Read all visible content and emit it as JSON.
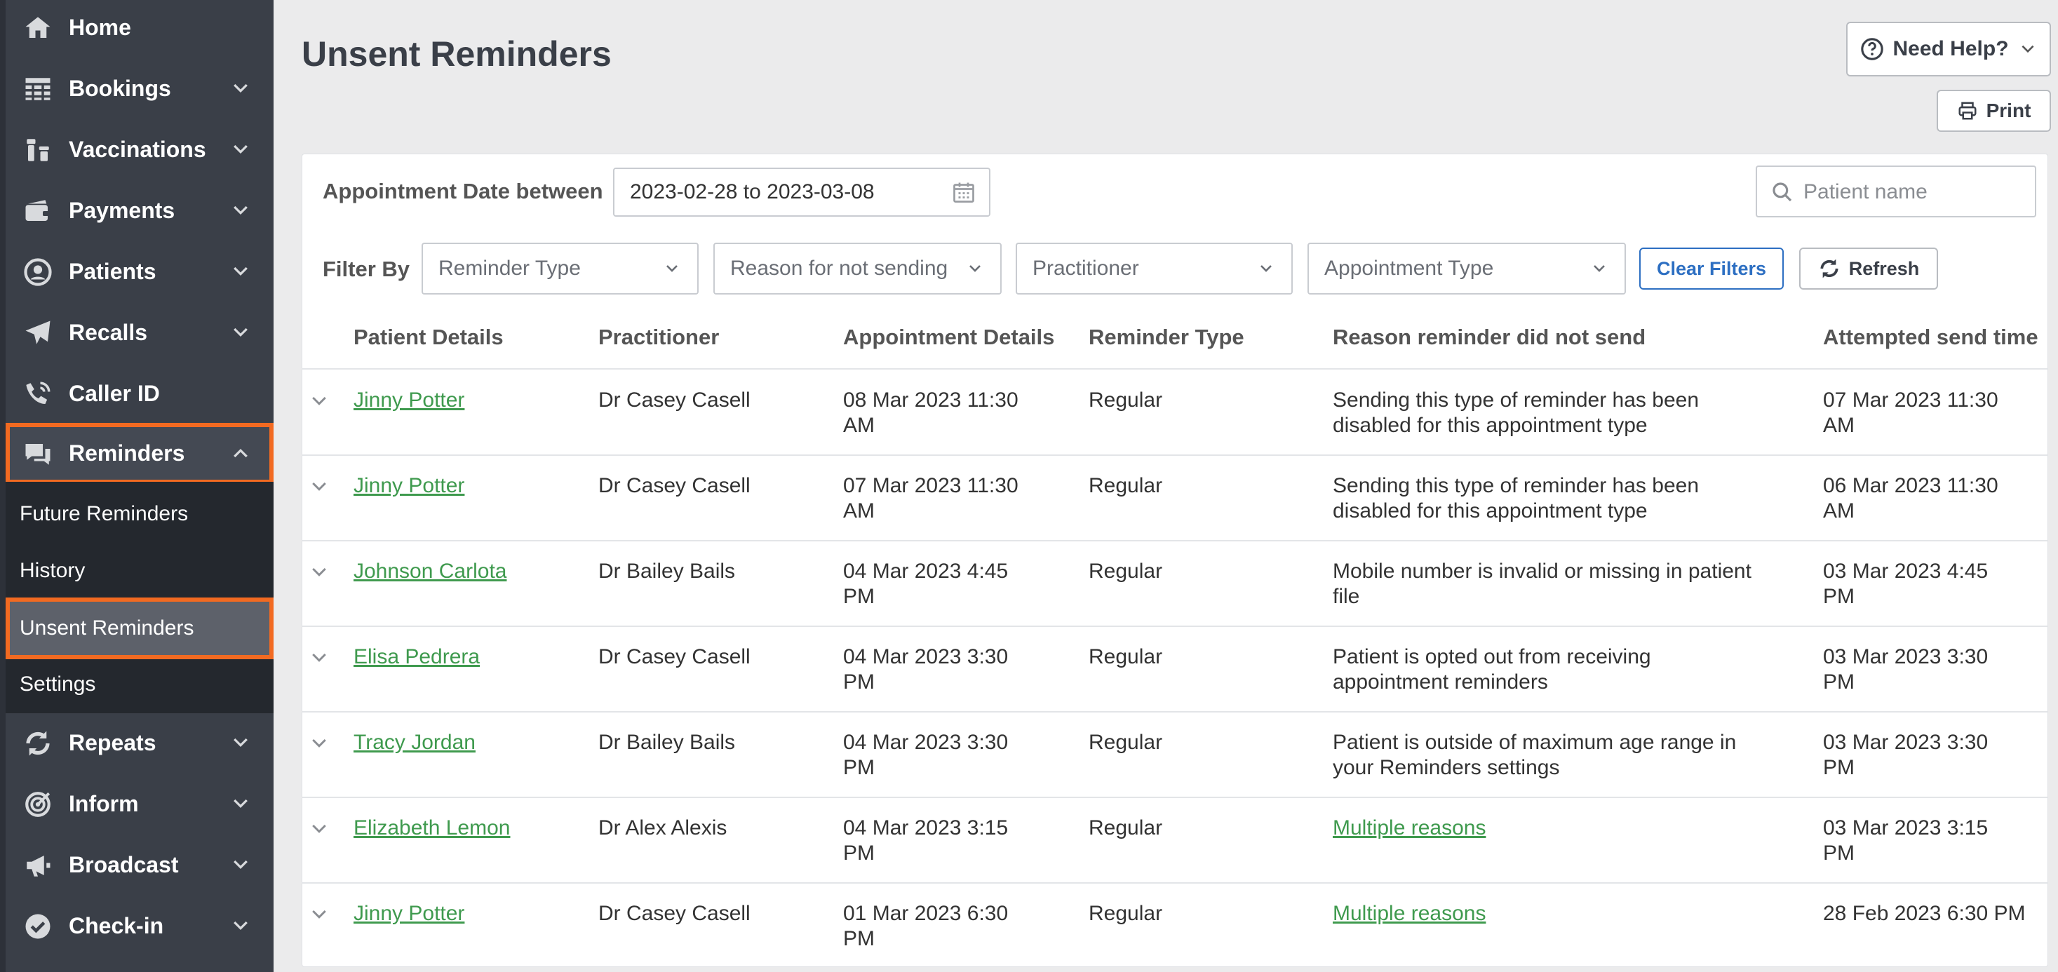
{
  "sidebar": {
    "items": [
      {
        "label": "Home",
        "icon": "home-icon",
        "has_chevron": false
      },
      {
        "label": "Bookings",
        "icon": "calendar-grid-icon",
        "has_chevron": true
      },
      {
        "label": "Vaccinations",
        "icon": "vials-icon",
        "has_chevron": true
      },
      {
        "label": "Payments",
        "icon": "card-payment-icon",
        "has_chevron": true
      },
      {
        "label": "Patients",
        "icon": "user-circle-icon",
        "has_chevron": true
      },
      {
        "label": "Recalls",
        "icon": "paper-plane-icon",
        "has_chevron": true
      },
      {
        "label": "Caller ID",
        "icon": "phone-icon",
        "has_chevron": false
      },
      {
        "label": "Reminders",
        "icon": "chat-bubbles-icon",
        "has_chevron": true,
        "expanded": true
      },
      {
        "label": "Repeats",
        "icon": "repeat-icon",
        "has_chevron": true
      },
      {
        "label": "Inform",
        "icon": "target-icon",
        "has_chevron": true
      },
      {
        "label": "Broadcast",
        "icon": "megaphone-icon",
        "has_chevron": true
      },
      {
        "label": "Check-in",
        "icon": "check-badge-icon",
        "has_chevron": true
      }
    ],
    "reminders_submenu": [
      {
        "label": "Future Reminders"
      },
      {
        "label": "History"
      },
      {
        "label": "Unsent Reminders",
        "active": true
      },
      {
        "label": "Settings"
      }
    ],
    "highlight_color": "#f26a21"
  },
  "header": {
    "title": "Unsent Reminders",
    "help_label": "Need Help?",
    "print_label": "Print"
  },
  "filters": {
    "date_label": "Appointment Date between",
    "date_value": "2023-02-28 to 2023-03-08",
    "search_placeholder": "Patient name",
    "filter_by_label": "Filter By",
    "reminder_type": "Reminder Type",
    "reason": "Reason for not sending",
    "practitioner": "Practitioner",
    "appointment_type": "Appointment Type",
    "clear_label": "Clear Filters",
    "refresh_label": "Refresh"
  },
  "table": {
    "columns": [
      "Patient Details",
      "Practitioner",
      "Appointment Details",
      "Reminder Type",
      "Reason reminder did not send",
      "Attempted send time"
    ],
    "rows": [
      {
        "patient": "Jinny Potter",
        "practitioner": "Dr Casey Casell",
        "appt_1": "08 Mar 2023 11:30",
        "appt_2": "AM",
        "type": "Regular",
        "reason_1": "Sending this type of reminder has been",
        "reason_2": "disabled for this appointment type",
        "reason_link": false,
        "sent_1": "07 Mar 2023 11:30",
        "sent_2": "AM"
      },
      {
        "patient": "Jinny Potter",
        "practitioner": "Dr Casey Casell",
        "appt_1": "07 Mar 2023 11:30",
        "appt_2": "AM",
        "type": "Regular",
        "reason_1": "Sending this type of reminder has been",
        "reason_2": "disabled for this appointment type",
        "reason_link": false,
        "sent_1": "06 Mar 2023 11:30",
        "sent_2": "AM"
      },
      {
        "patient": "Johnson Carlota",
        "practitioner": "Dr Bailey Bails",
        "appt_1": "04 Mar 2023 4:45",
        "appt_2": "PM",
        "type": "Regular",
        "reason_1": "Mobile number is invalid or missing in patient",
        "reason_2": "file",
        "reason_link": false,
        "sent_1": "03 Mar 2023 4:45",
        "sent_2": "PM"
      },
      {
        "patient": "Elisa Pedrera",
        "practitioner": "Dr Casey Casell",
        "appt_1": "04 Mar 2023 3:30",
        "appt_2": "PM",
        "type": "Regular",
        "reason_1": "Patient is opted out from receiving",
        "reason_2": "appointment reminders",
        "reason_link": false,
        "sent_1": "03 Mar 2023 3:30",
        "sent_2": "PM"
      },
      {
        "patient": "Tracy Jordan",
        "practitioner": "Dr Bailey Bails",
        "appt_1": "04 Mar 2023 3:30",
        "appt_2": "PM",
        "type": "Regular",
        "reason_1": "Patient is outside of maximum age range in",
        "reason_2": "your Reminders settings",
        "reason_link": false,
        "sent_1": "03 Mar 2023 3:30",
        "sent_2": "PM"
      },
      {
        "patient": "Elizabeth Lemon",
        "practitioner": "Dr Alex Alexis",
        "appt_1": "04 Mar 2023 3:15",
        "appt_2": "PM",
        "type": "Regular",
        "reason_1": "Multiple reasons",
        "reason_2": "",
        "reason_link": true,
        "sent_1": "03 Mar 2023 3:15",
        "sent_2": "PM"
      },
      {
        "patient": "Jinny Potter",
        "practitioner": "Dr Casey Casell",
        "appt_1": "01 Mar 2023 6:30",
        "appt_2": "PM",
        "type": "Regular",
        "reason_1": "Multiple reasons",
        "reason_2": "",
        "reason_link": true,
        "sent_1": "28 Feb 2023 6:30 PM",
        "sent_2": ""
      }
    ]
  },
  "colors": {
    "sidebar_bg": "#3a3f48",
    "link_green": "#3f9a4e",
    "accent_blue": "#2d6fc2"
  }
}
